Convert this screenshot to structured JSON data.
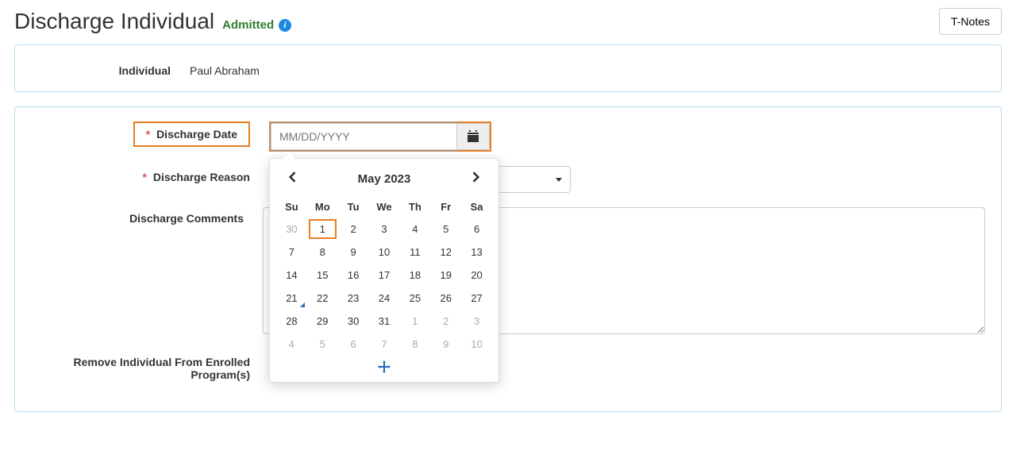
{
  "header": {
    "title": "Discharge Individual",
    "status": "Admitted",
    "tnotes_label": "T-Notes"
  },
  "individual": {
    "label": "Individual",
    "name": "Paul Abraham"
  },
  "form": {
    "discharge_date": {
      "label": "Discharge Date",
      "placeholder": "MM/DD/YYYY",
      "value": ""
    },
    "discharge_reason": {
      "label": "Discharge Reason"
    },
    "discharge_comments": {
      "label": "Discharge Comments",
      "value": ""
    },
    "remove_programs": {
      "label": "Remove Individual From Enrolled Program(s)"
    }
  },
  "datepicker": {
    "month_title": "May 2023",
    "dow": [
      "Su",
      "Mo",
      "Tu",
      "We",
      "Th",
      "Fr",
      "Sa"
    ],
    "days": [
      {
        "n": "30",
        "muted": true
      },
      {
        "n": "1",
        "sel": true
      },
      {
        "n": "2"
      },
      {
        "n": "3"
      },
      {
        "n": "4"
      },
      {
        "n": "5"
      },
      {
        "n": "6"
      },
      {
        "n": "7"
      },
      {
        "n": "8"
      },
      {
        "n": "9"
      },
      {
        "n": "10"
      },
      {
        "n": "11"
      },
      {
        "n": "12"
      },
      {
        "n": "13"
      },
      {
        "n": "14"
      },
      {
        "n": "15"
      },
      {
        "n": "16"
      },
      {
        "n": "17"
      },
      {
        "n": "18"
      },
      {
        "n": "19"
      },
      {
        "n": "20"
      },
      {
        "n": "21",
        "today": true
      },
      {
        "n": "22"
      },
      {
        "n": "23"
      },
      {
        "n": "24"
      },
      {
        "n": "25"
      },
      {
        "n": "26"
      },
      {
        "n": "27"
      },
      {
        "n": "28"
      },
      {
        "n": "29"
      },
      {
        "n": "30"
      },
      {
        "n": "31"
      },
      {
        "n": "1",
        "muted": true
      },
      {
        "n": "2",
        "muted": true
      },
      {
        "n": "3",
        "muted": true
      },
      {
        "n": "4",
        "muted": true
      },
      {
        "n": "5",
        "muted": true
      },
      {
        "n": "6",
        "muted": true
      },
      {
        "n": "7",
        "muted": true
      },
      {
        "n": "8",
        "muted": true
      },
      {
        "n": "9",
        "muted": true
      },
      {
        "n": "10",
        "muted": true
      }
    ]
  }
}
